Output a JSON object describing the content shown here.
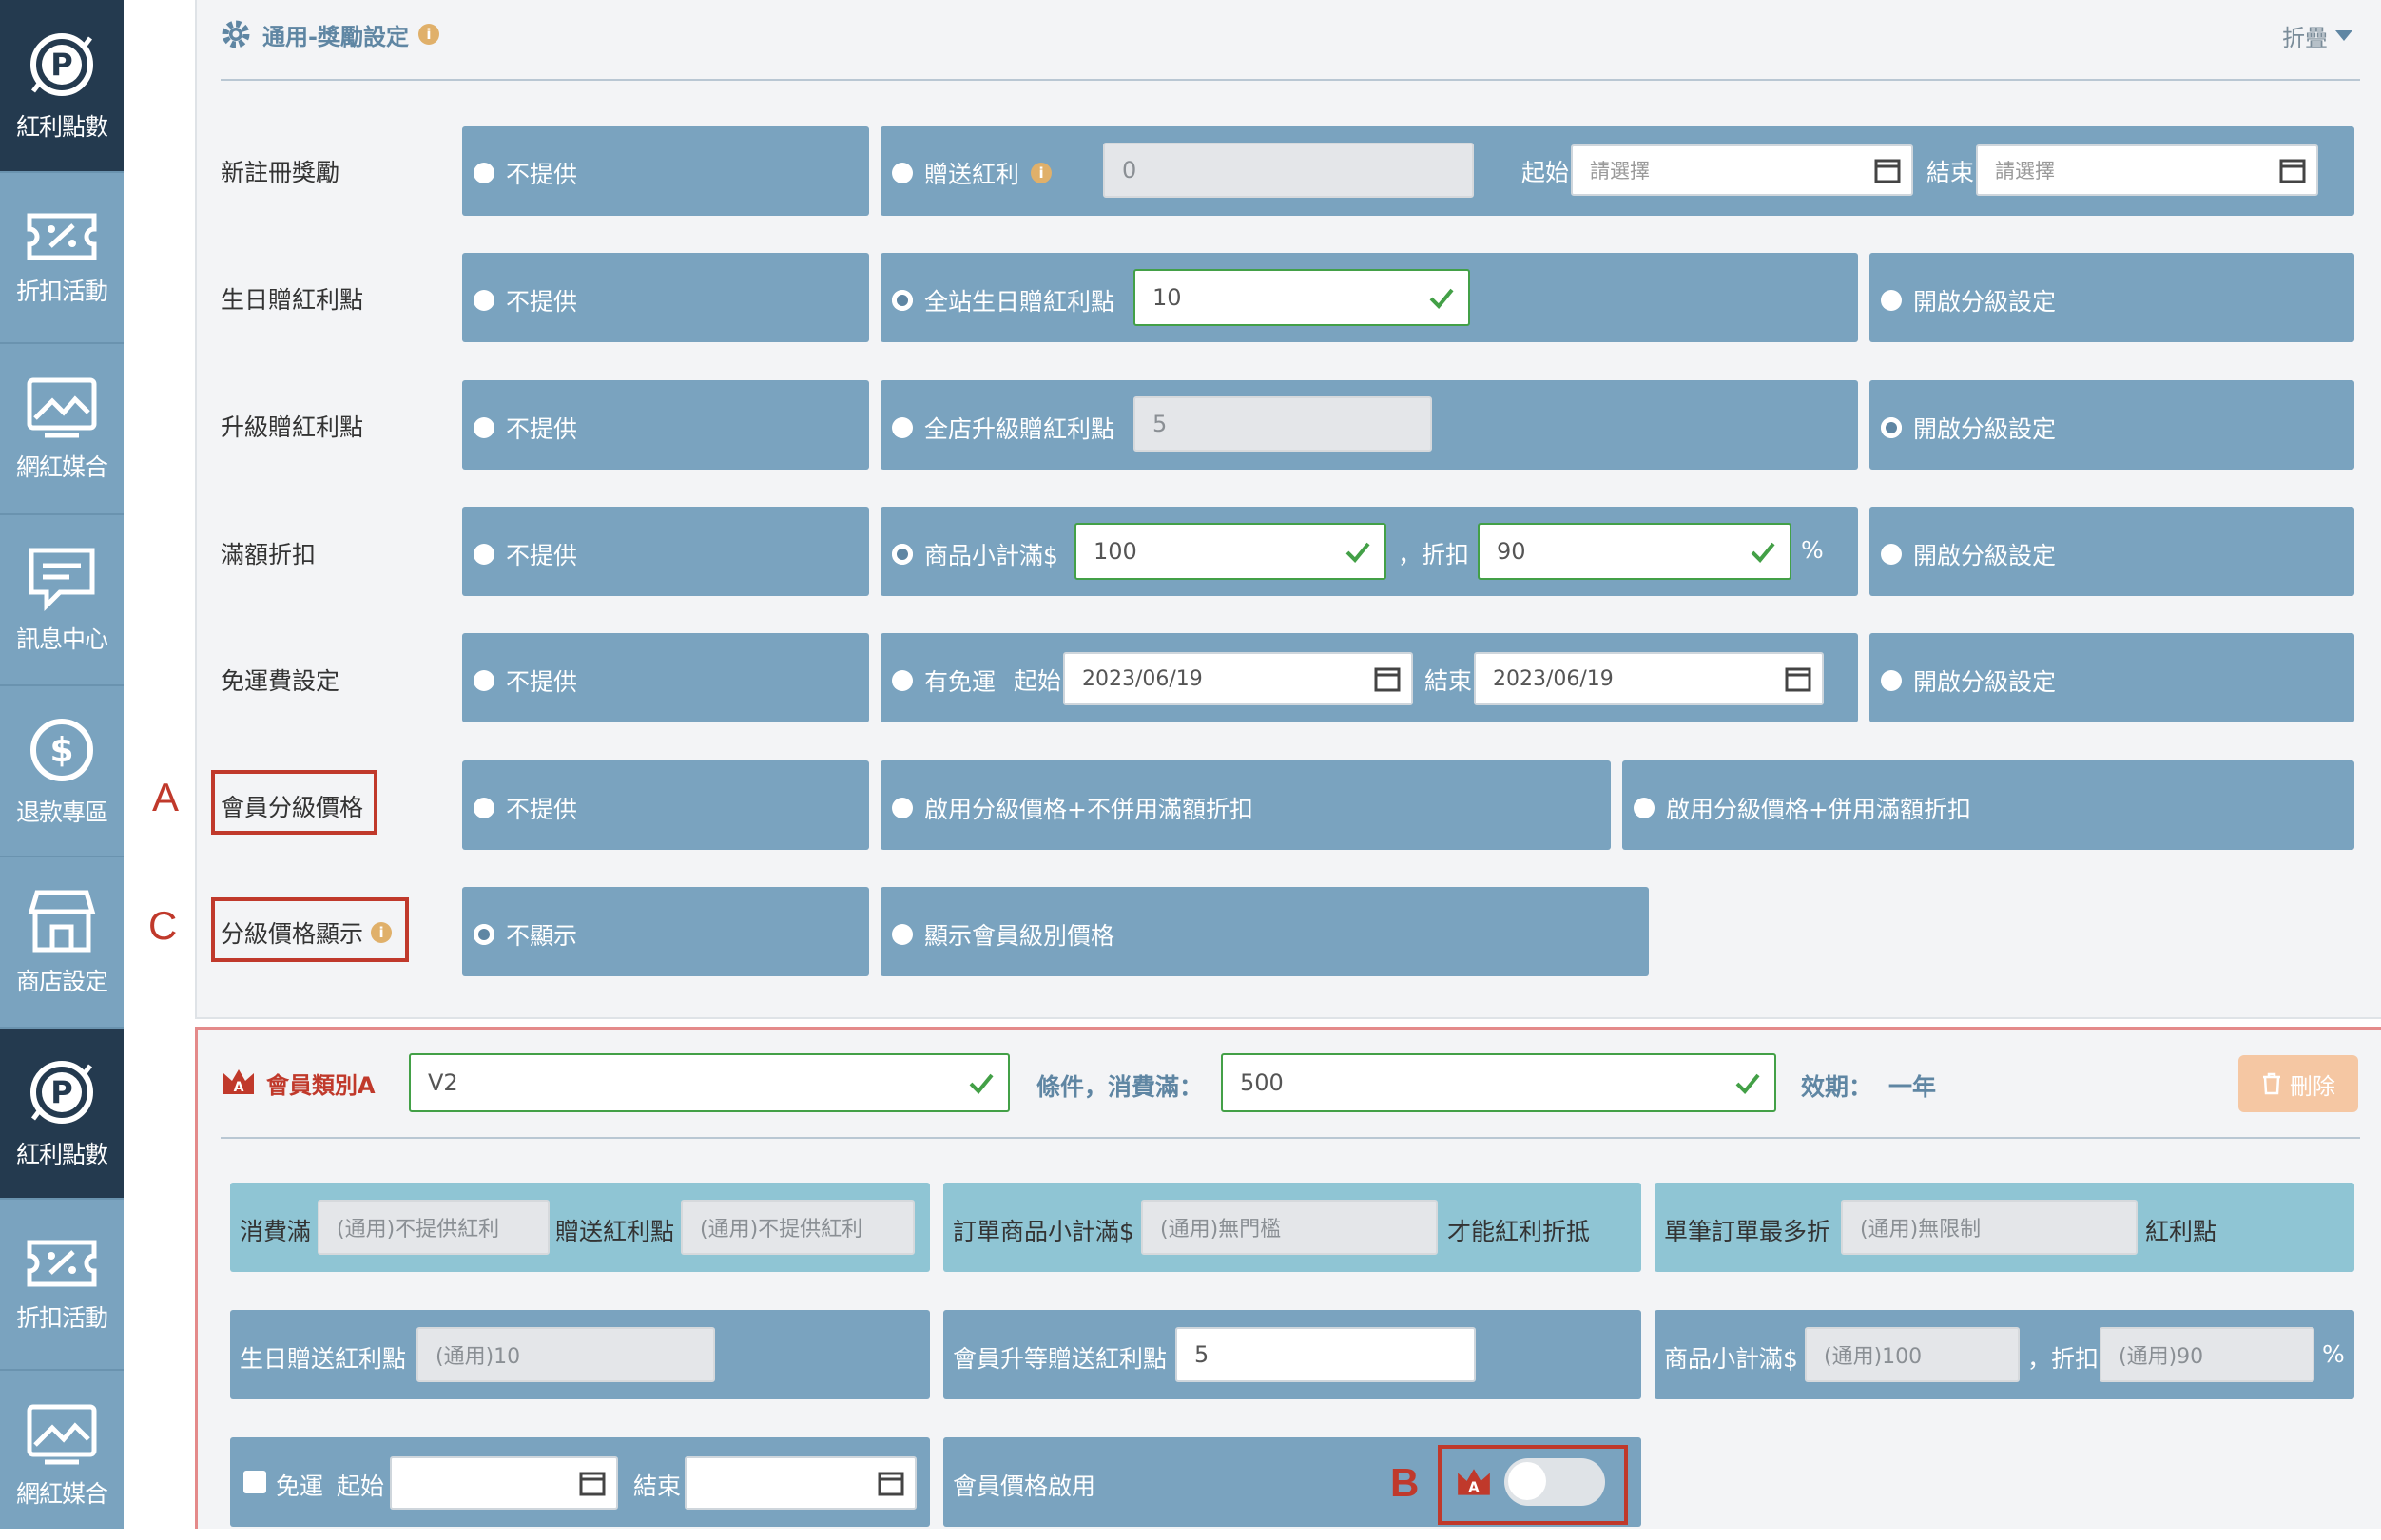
{
  "sidebar": {
    "items": [
      {
        "label": "紅利點數",
        "icon": "points-icon",
        "active": true
      },
      {
        "label": "折扣活動",
        "icon": "discount-ticket-icon"
      },
      {
        "label": "網紅媒合",
        "icon": "influencer-icon"
      },
      {
        "label": "訊息中心",
        "icon": "message-icon"
      },
      {
        "label": "退款專區",
        "icon": "refund-icon"
      },
      {
        "label": "商店設定",
        "icon": "store-icon"
      },
      {
        "label": "紅利點數",
        "icon": "points-icon",
        "active": true
      },
      {
        "label": "折扣活動",
        "icon": "discount-ticket-icon"
      },
      {
        "label": "網紅媒合",
        "icon": "influencer-icon"
      }
    ]
  },
  "header": {
    "title": "通用-獎勵設定",
    "collapse": "折疊"
  },
  "rows": {
    "signup": {
      "label": "新註冊獎勵",
      "none": "不提供",
      "gift": "贈送紅利",
      "gift_value": "0",
      "start": "起始",
      "start_ph": "請選擇",
      "end": "結束",
      "end_ph": "請選擇"
    },
    "birthday": {
      "label": "生日贈紅利點",
      "none": "不提供",
      "site": "全站生日贈紅利點",
      "site_value": "10",
      "tier": "開啟分級設定"
    },
    "upgrade": {
      "label": "升級贈紅利點",
      "none": "不提供",
      "store": "全店升級贈紅利點",
      "store_value": "5",
      "tier": "開啟分級設定"
    },
    "fullcut": {
      "label": "滿額折扣",
      "none": "不提供",
      "subtotal": "商品小計滿$",
      "subtotal_value": "100",
      "discount": "，折扣",
      "discount_value": "90",
      "percent": "%",
      "tier": "開啟分級設定"
    },
    "shipping": {
      "label": "免運費設定",
      "none": "不提供",
      "has": "有免運",
      "start": "起始",
      "start_value": "2023/06/19",
      "end": "結束",
      "end_value": "2023/06/19",
      "tier": "開啟分級設定"
    },
    "member_price": {
      "label": "會員分級價格",
      "none": "不提供",
      "opt1": "啟用分級價格+不併用滿額折扣",
      "opt2": "啟用分級價格+併用滿額折扣"
    },
    "price_display": {
      "label": "分級價格顯示",
      "none": "不顯示",
      "show": "顯示會員級別價格"
    }
  },
  "markers": {
    "a": "A",
    "b": "B",
    "c": "C"
  },
  "member": {
    "title": "會員類別A",
    "name_value": "V2",
    "condition": "條件，消費滿：",
    "condition_value": "500",
    "validity": "效期：",
    "validity_value": "一年",
    "delete": "刪除",
    "r1": {
      "spend": "消費滿",
      "spend_value": "(通用)不提供紅利",
      "gift": "贈送紅利點",
      "gift_value": "(通用)不提供紅利",
      "order": "訂單商品小計滿$",
      "order_value": "(通用)無門檻",
      "order_suffix": "才能紅利折抵",
      "max": "單筆訂單最多折",
      "max_value": "(通用)無限制",
      "max_suffix": "紅利點"
    },
    "r2": {
      "bday": "生日贈送紅利點",
      "bday_value": "(通用)10",
      "upgrade": "會員升等贈送紅利點",
      "upgrade_value": "5",
      "subtotal": "商品小計滿$",
      "subtotal_value": "(通用)100",
      "discount": "，折扣",
      "discount_value": "(通用)90",
      "percent": "%"
    },
    "r3": {
      "free": "免運",
      "start": "起始",
      "end": "結束",
      "price_enable": "會員價格啟用"
    }
  },
  "colors": {
    "sidebar": "#7aa3bf",
    "sidebar_active": "#243a4f",
    "option_box": "#7aa3bf",
    "light_box": "#8fc5d4",
    "accent": "#5f86a3",
    "valid": "#43a047",
    "highlight": "#c0392b",
    "delete": "#f5c7a3"
  }
}
